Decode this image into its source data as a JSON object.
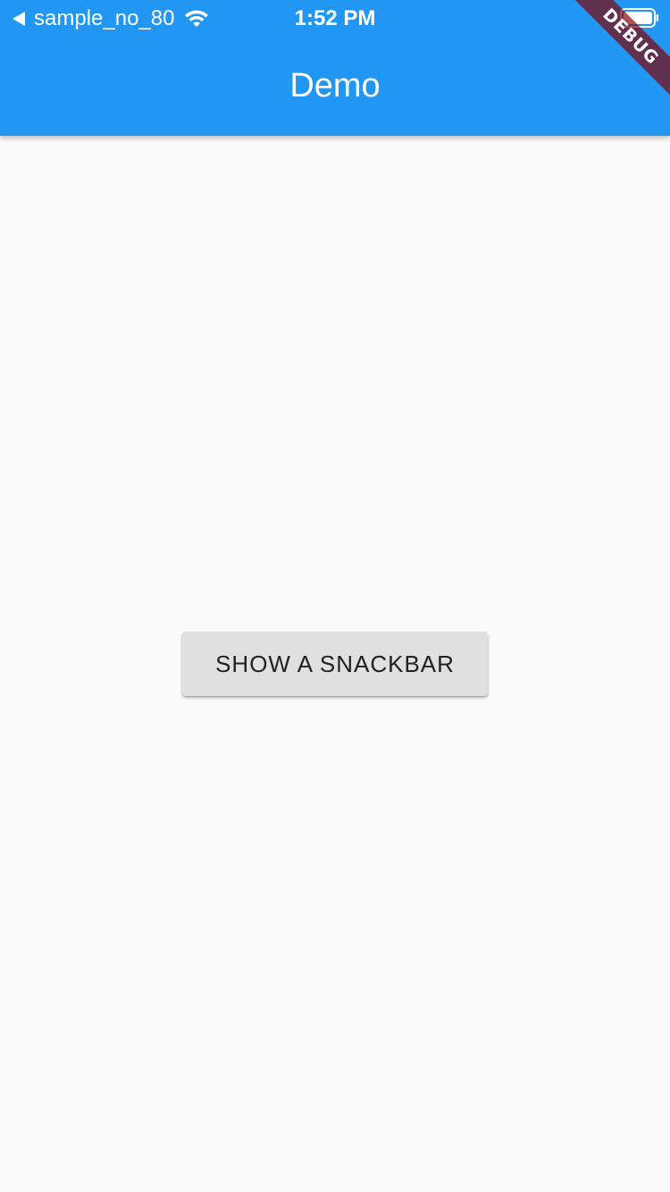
{
  "status_bar": {
    "carrier": "sample_no_80",
    "time": "1:52 PM",
    "back_icon": "back-triangle-icon",
    "wifi_icon": "wifi-icon",
    "battery_icon": "battery-icon"
  },
  "app_bar": {
    "title": "Demo",
    "color": "#2196f3"
  },
  "debug_banner": {
    "label": "DEBUG"
  },
  "main": {
    "button_label": "SHOW A SNACKBAR",
    "button_color": "#e0e0e0"
  }
}
